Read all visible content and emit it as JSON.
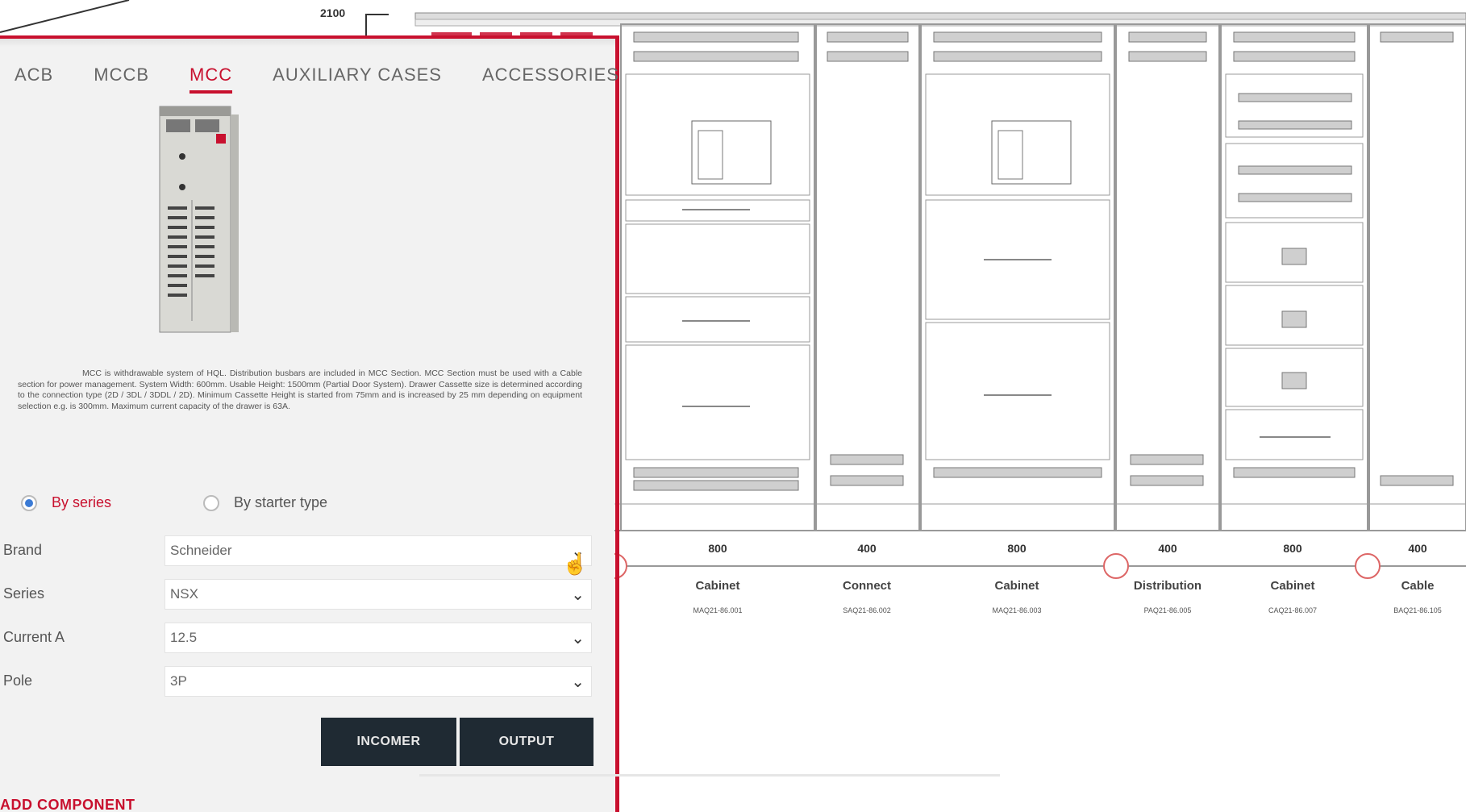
{
  "dimension_label": "2100",
  "tabs": [
    {
      "label": "ACB",
      "active": false
    },
    {
      "label": "MCCB",
      "active": false
    },
    {
      "label": "MCC",
      "active": true
    },
    {
      "label": "AUXILIARY CASES",
      "active": false
    },
    {
      "label": "ACCESSORIES",
      "active": false
    }
  ],
  "description": "MCC is withdrawable system of HQL. Distribution busbars are included in MCC Section. MCC Section must be used with a Cable section for power management. System Width: 600mm. Usable Height: 1500mm (Partial Door System). Drawer Cassette size is determined according to the connection type (2D / 3DL / 3DDL / 2D). Minimum Cassette Height is started from 75mm and is increased by 25 mm depending on equipment selection e.g. is 300mm. Maximum current capacity of the drawer is 63A.",
  "radios": {
    "by_series": "By series",
    "by_starter": "By starter type"
  },
  "fields": {
    "brand": {
      "label": "Brand",
      "value": "Schneider"
    },
    "series": {
      "label": "Series",
      "value": "NSX"
    },
    "current": {
      "label": "Current A",
      "value": "12.5"
    },
    "pole": {
      "label": "Pole",
      "value": "3P"
    }
  },
  "buttons": {
    "incomer": "INCOMER",
    "output": "OUTPUT"
  },
  "add_component": "ADD COMPONENT",
  "sections": [
    {
      "num": "800",
      "name": "Cabinet",
      "code": "MAQ21-86.001"
    },
    {
      "num": "400",
      "name": "Connect",
      "code": "SAQ21-86.002"
    },
    {
      "num": "800",
      "name": "Cabinet",
      "code": "MAQ21-86.003"
    },
    {
      "num": "400",
      "name": "Distribution",
      "code": "PAQ21-86.005"
    },
    {
      "num": "800",
      "name": "Cabinet",
      "code": "CAQ21-86.007"
    },
    {
      "num": "400",
      "name": "Cable",
      "code": "BAQ21-86.105"
    }
  ],
  "colors": {
    "accent": "#c8102e",
    "button": "#1f2a33",
    "panel": "#f2f2f2"
  },
  "icons": [
    "chevron-down-icon",
    "cursor-hand-icon"
  ]
}
